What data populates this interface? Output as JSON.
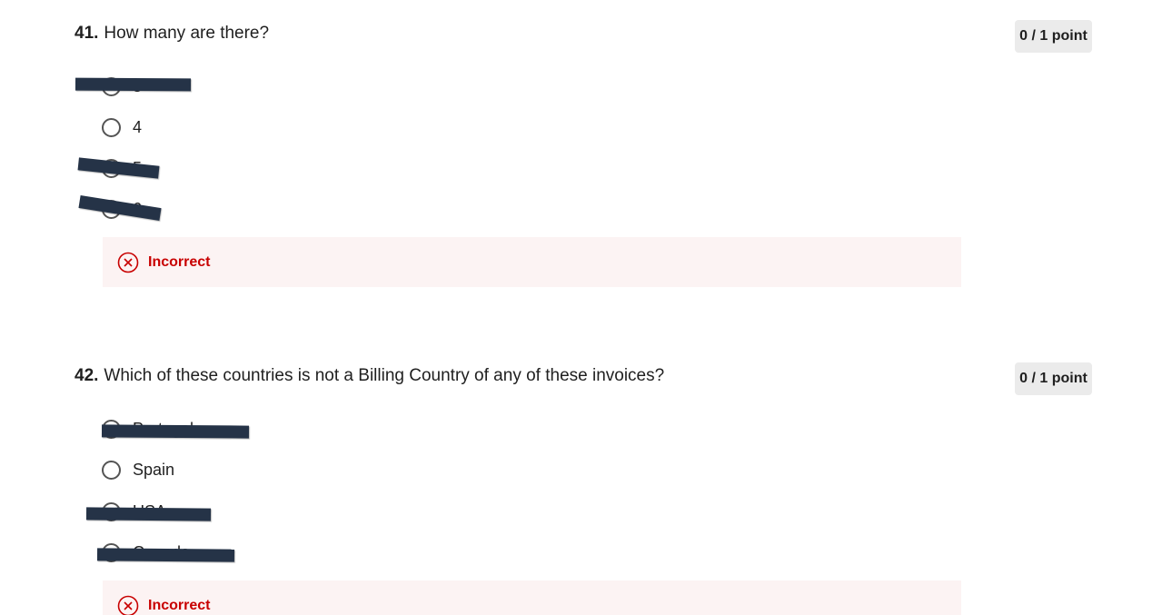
{
  "questions": [
    {
      "number": "41.",
      "text": "How many are there?",
      "points": "0 / 1 point",
      "options": [
        {
          "label": "3",
          "redacted": true
        },
        {
          "label": "4",
          "redacted": false
        },
        {
          "label": "5",
          "redacted": true
        },
        {
          "label": "6",
          "redacted": true
        }
      ],
      "feedback": "Incorrect"
    },
    {
      "number": "42.",
      "text": "Which of these countries is not a Billing Country of any of these invoices?",
      "points": "0 / 1 point",
      "options": [
        {
          "label": "Portugal",
          "redacted": true
        },
        {
          "label": "Spain",
          "redacted": false
        },
        {
          "label": "USA",
          "redacted": true
        },
        {
          "label": "Canada",
          "redacted": true
        }
      ],
      "feedback": "Incorrect"
    }
  ],
  "icons": {
    "radio": "radio-button-icon",
    "incorrect": "x-circle-icon"
  },
  "colors": {
    "incorrect_text": "#c80000",
    "feedback_bg": "#fcf3f3",
    "points_badge_bg": "#ebebeb",
    "redaction": "#253347"
  }
}
